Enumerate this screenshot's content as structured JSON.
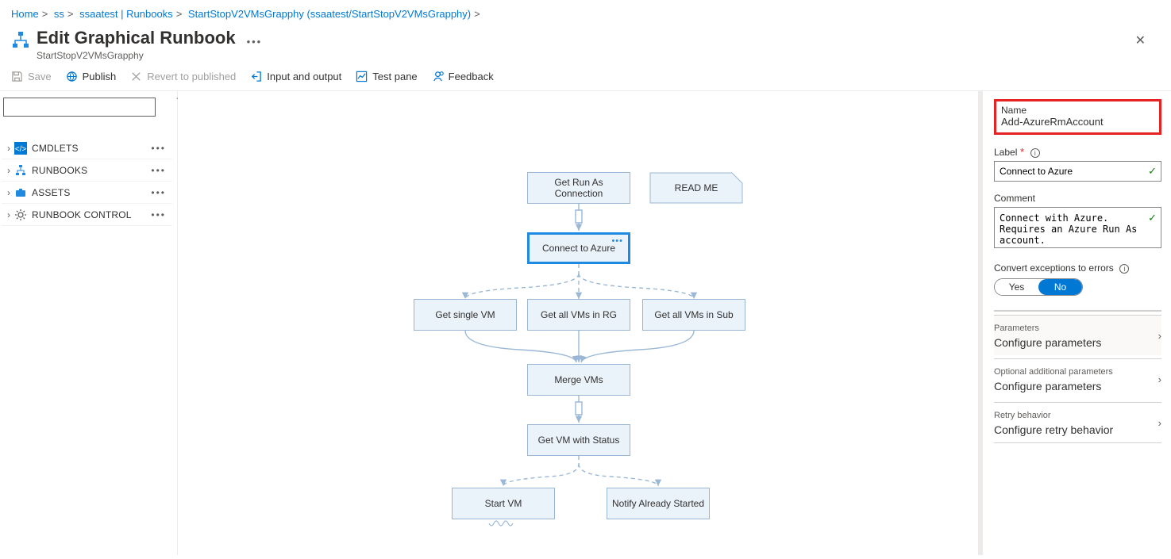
{
  "breadcrumb": [
    "Home",
    "ss",
    "ssaatest | Runbooks",
    "StartStopV2VMsGrapphy (ssaatest/StartStopV2VMsGrapphy)"
  ],
  "title": "Edit Graphical Runbook",
  "subtitle": "StartStopV2VMsGrapphy",
  "toolbar": {
    "save": "Save",
    "publish": "Publish",
    "revert": "Revert to published",
    "io": "Input and output",
    "test": "Test pane",
    "feedback": "Feedback"
  },
  "tree": [
    {
      "label": "CMDLETS",
      "icon": "code"
    },
    {
      "label": "RUNBOOKS",
      "icon": "flow"
    },
    {
      "label": "ASSETS",
      "icon": "briefcase"
    },
    {
      "label": "RUNBOOK CONTROL",
      "icon": "gear"
    }
  ],
  "nodes": {
    "getconn": "Get Run As Connection",
    "readme": "READ ME",
    "connect": "Connect to Azure",
    "single": "Get single VM",
    "rg": "Get all VMs in RG",
    "sub": "Get all VMs in Sub",
    "merge": "Merge VMs",
    "status": "Get VM with Status",
    "start": "Start VM",
    "notify": "Notify Already Started"
  },
  "props": {
    "name_label": "Name",
    "name_value": "Add-AzureRmAccount",
    "label_label": "Label",
    "label_value": "Connect to Azure",
    "comment_label": "Comment",
    "comment_value": "Connect with Azure.  Requires an Azure Run As account.",
    "convert_label": "Convert exceptions to errors",
    "yes": "Yes",
    "no": "No",
    "rows": [
      {
        "small": "Parameters",
        "big": "Configure parameters"
      },
      {
        "small": "Optional additional parameters",
        "big": "Configure parameters"
      },
      {
        "small": "Retry behavior",
        "big": "Configure retry behavior"
      }
    ]
  }
}
